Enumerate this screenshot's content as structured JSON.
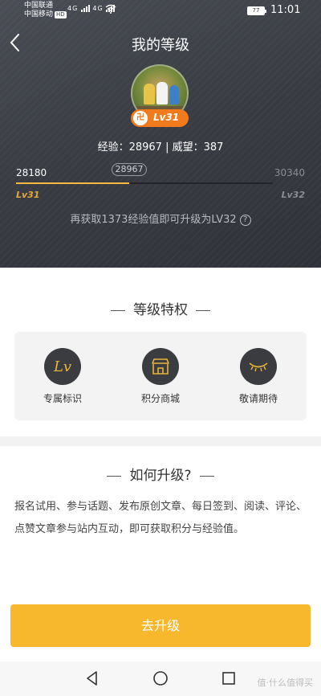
{
  "status_bar": {
    "carrier1": "中国联通",
    "carrier2": "中国移动",
    "hd": "HD",
    "net1": "4G",
    "net2": "4G",
    "battery": "77",
    "time": "11:01"
  },
  "header": {
    "title": "我的等级"
  },
  "profile": {
    "level_badge": "Lv31",
    "badge_icon": "卍",
    "stats": "经验：28967 | 威望：387"
  },
  "progress": {
    "start": "28180",
    "current": "28967",
    "end": "30340",
    "level_from": "Lv31",
    "level_to": "Lv32",
    "fill_fraction": 0.44,
    "hint": "再获取1373经验值即可升级为LV32",
    "help": "?"
  },
  "privileges": {
    "title": "等级特权",
    "items": [
      {
        "label": "专属标识",
        "icon": "lv-icon",
        "glyph": "Lv"
      },
      {
        "label": "积分商城",
        "icon": "store-icon"
      },
      {
        "label": "敬请期待",
        "icon": "closed-eye-icon"
      }
    ]
  },
  "how_to": {
    "title": "如何升级?",
    "text": "报名试用、参与话题、发布原创文章、每日签到、阅读、评论、点赞文章参与站内互动，即可获取积分与经验值。"
  },
  "action": {
    "upgrade_label": "去升级"
  },
  "nav": {
    "watermark": "值·什么值得买"
  },
  "colors": {
    "accent": "#f7b82e",
    "hero_bg": "#3a3d44",
    "badge": "#f07a1c",
    "progress_fill": "#f5b942"
  }
}
